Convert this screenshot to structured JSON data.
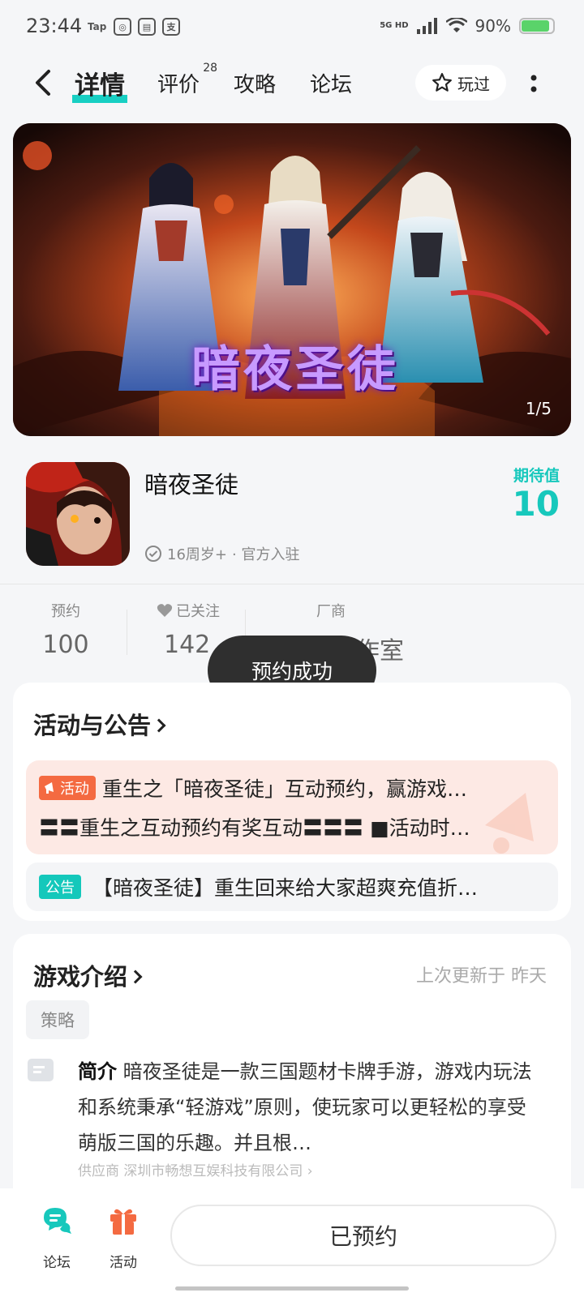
{
  "status_bar": {
    "time": "23:44",
    "tap_label": "Tap",
    "network": "5G HD",
    "battery": "90%",
    "battery_level": 0.9
  },
  "nav": {
    "tabs": [
      {
        "label": "详情",
        "active": true
      },
      {
        "label": "评价",
        "badge": "28"
      },
      {
        "label": "攻略"
      },
      {
        "label": "论坛"
      }
    ],
    "played_label": "玩过"
  },
  "banner": {
    "art_title": "暗夜圣徒",
    "counter": "1/5"
  },
  "game": {
    "title": "暗夜圣徒",
    "age": "16周岁+",
    "official": "· 官方入驻",
    "expect_label": "期待值",
    "expect_value": "10"
  },
  "stats": [
    {
      "label": "预约",
      "value": "100"
    },
    {
      "label": "已关注",
      "value": "142"
    },
    {
      "label": "厂商",
      "value": "小游渡工作室"
    }
  ],
  "toast": "预约成功",
  "activities": {
    "title": "活动与公告",
    "activity_tag": "活动",
    "activity_line1": "重生之「暗夜圣徒」互动预约，赢游戏…",
    "activity_line2": "〓〓重生之互动预约有奖互动〓〓〓 ■活动时…",
    "notice_tag": "公告",
    "notice_text": "【暗夜圣徒】重生回来给大家超爽充值折…"
  },
  "intro": {
    "title": "游戏介绍",
    "updated": "上次更新于 昨天",
    "tag": "策略",
    "heading": "简介",
    "text": "暗夜圣徒是一款三国题材卡牌手游，游戏内玩法和系统秉承“轻游戏”原则，使玩家可以更轻松的享受萌版三国的乐趣。并且根…",
    "supplier": "供应商 深圳市畅想互娱科技有限公司"
  },
  "bottom": {
    "forum_label": "论坛",
    "activity_label": "活动",
    "reserved_label": "已预约"
  },
  "colors": {
    "accent": "#18cfc3",
    "activity_tag": "#f46a41",
    "activity_bg": "#fde9e4",
    "toast_bg": "#2f2f2f"
  }
}
